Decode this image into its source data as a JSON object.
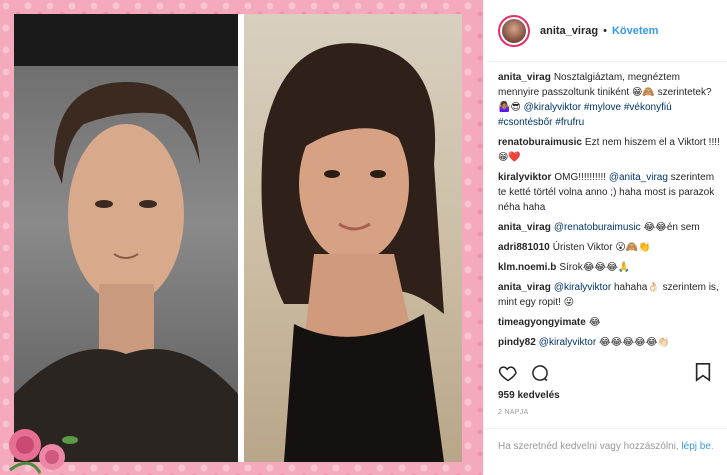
{
  "post": {
    "username": "anita_virag",
    "follow_label": "Követem",
    "separator": "•"
  },
  "comments": [
    {
      "user": "anita_virag",
      "parts": [
        {
          "t": "Nosztalgiáztam, megnéztem mennyire passzoltunk tiniként 😁🙈 szerintetek?🤷🏽‍♀️😎 "
        },
        {
          "t": "@kiralyviktor",
          "m": true
        },
        {
          "t": " "
        },
        {
          "t": "#mylove",
          "m": true
        },
        {
          "t": " "
        },
        {
          "t": "#vékonyfiú",
          "m": true
        },
        {
          "t": " "
        },
        {
          "t": "#csontésbőr",
          "m": true
        },
        {
          "t": " "
        },
        {
          "t": "#frufru",
          "m": true
        }
      ]
    },
    {
      "user": "renatoburaimusic",
      "parts": [
        {
          "t": "Ezt nem hiszem el a Viktort !!!! 😁❤️"
        }
      ]
    },
    {
      "user": "kiralyviktor",
      "parts": [
        {
          "t": "OMG!!!!!!!!!! "
        },
        {
          "t": "@anita_virag",
          "m": true
        },
        {
          "t": " szerintem te ketté törtél volna anno ;) haha most is parazok néha haha"
        }
      ]
    },
    {
      "user": "anita_virag",
      "parts": [
        {
          "t": "@renatoburaimusic",
          "m": true
        },
        {
          "t": " 😂😂én sem"
        }
      ]
    },
    {
      "user": "adri881010",
      "parts": [
        {
          "t": "Úristen Viktor 😮🙈👏"
        }
      ]
    },
    {
      "user": "klm.noemi.b",
      "parts": [
        {
          "t": "Sírok😂😂😂🙏"
        }
      ]
    },
    {
      "user": "anita_virag",
      "parts": [
        {
          "t": "@kiralyviktor",
          "m": true
        },
        {
          "t": " hahaha👌🏻 szerintem is, mint egy ropit! 😜"
        }
      ]
    },
    {
      "user": "timeagyongyimate",
      "parts": [
        {
          "t": "😂"
        }
      ]
    },
    {
      "user": "pindy82",
      "parts": [
        {
          "t": "@kiralyviktor",
          "m": true
        },
        {
          "t": " 😂😂😂😂😂👏🏻"
        }
      ]
    }
  ],
  "likes": "959 kedvelés",
  "time": "2 NAPJA",
  "login": {
    "prompt": "Ha szeretnéd kedvelni vagy hozzászólni, ",
    "link": "lépj be",
    "end": "."
  },
  "icons": {
    "like": "heart-outline-icon",
    "comment": "comment-bubble-icon",
    "save": "bookmark-icon"
  },
  "colors": {
    "accent_link": "#3897f0",
    "mention": "#003569",
    "frame_pink": "#f4a9bd"
  }
}
